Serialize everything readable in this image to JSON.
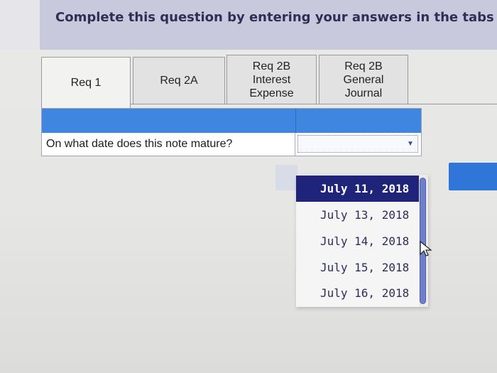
{
  "instruction": "Complete this question by entering your answers in the tabs b",
  "tabs": [
    {
      "label": "Req 1",
      "active": true
    },
    {
      "label": "Req 2A",
      "active": false
    },
    {
      "label": "Req 2B\nInterest\nExpense",
      "active": false
    },
    {
      "label": "Req 2B\nGeneral\nJournal",
      "active": false
    }
  ],
  "question": {
    "prompt": "On what date does this note mature?",
    "selected_value": ""
  },
  "dropdown": {
    "options": [
      "July 11, 2018",
      "July 13, 2018",
      "July 14, 2018",
      "July 15, 2018",
      "July 16, 2018"
    ],
    "highlighted": "July 11, 2018"
  },
  "colors": {
    "banner": "#c9c9dd",
    "table_header": "#3f86e1",
    "selected_option": "#1f237a",
    "accent_button": "#2f76d8"
  }
}
